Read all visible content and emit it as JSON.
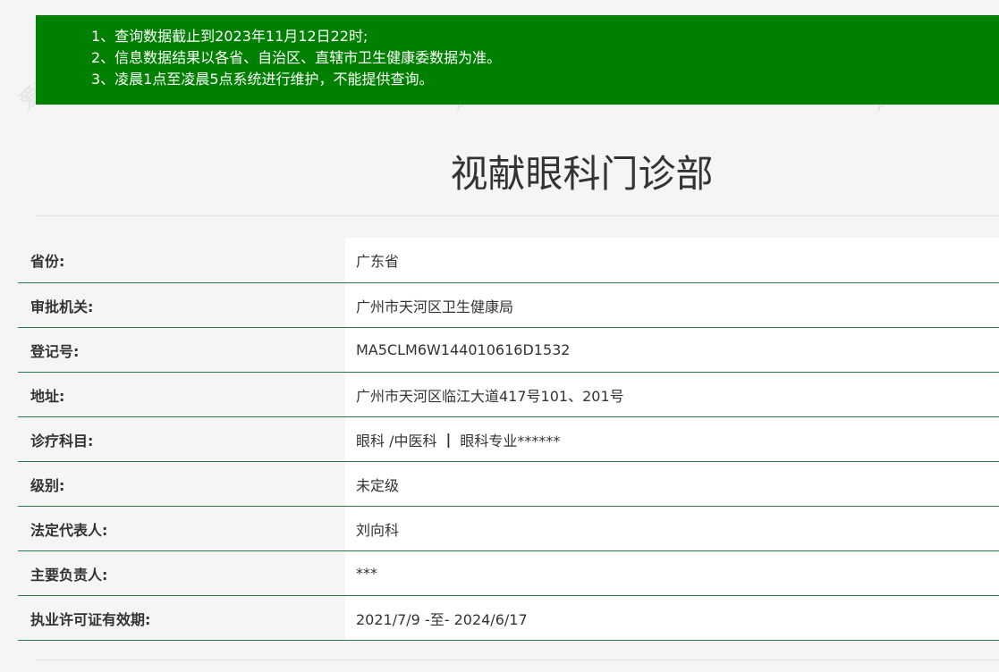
{
  "notice": {
    "lines": [
      "1、查询数据截止到2023年11月12日22时;",
      "2、信息数据结果以各省、自治区、直辖市卫生健康委数据为准。",
      "3、凌晨1点至凌晨5点系统进行维护，不能提供查询。"
    ]
  },
  "page": {
    "title": "视献眼科门诊部"
  },
  "info": {
    "rows": [
      {
        "label": "省份:",
        "value": "广东省"
      },
      {
        "label": "审批机关:",
        "value": "广州市天河区卫生健康局"
      },
      {
        "label": "登记号:",
        "value": "MA5CLM6W144010616D1532"
      },
      {
        "label": "地址:",
        "value": "广州市天河区临江大道417号101、201号"
      },
      {
        "label": "诊疗科目:",
        "value_part1": "眼科 /中医科",
        "separator": "|",
        "value_part2": "眼科专业******"
      },
      {
        "label": "级别:",
        "value": "未定级"
      },
      {
        "label": "法定代表人:",
        "value": "刘向科"
      },
      {
        "label": "主要负责人:",
        "value": "***"
      },
      {
        "label": "执业许可证有效期:",
        "value": "2021/7/9 -至- 2024/6/17"
      }
    ]
  },
  "watermark": {
    "text": "爱准◎眼科"
  }
}
